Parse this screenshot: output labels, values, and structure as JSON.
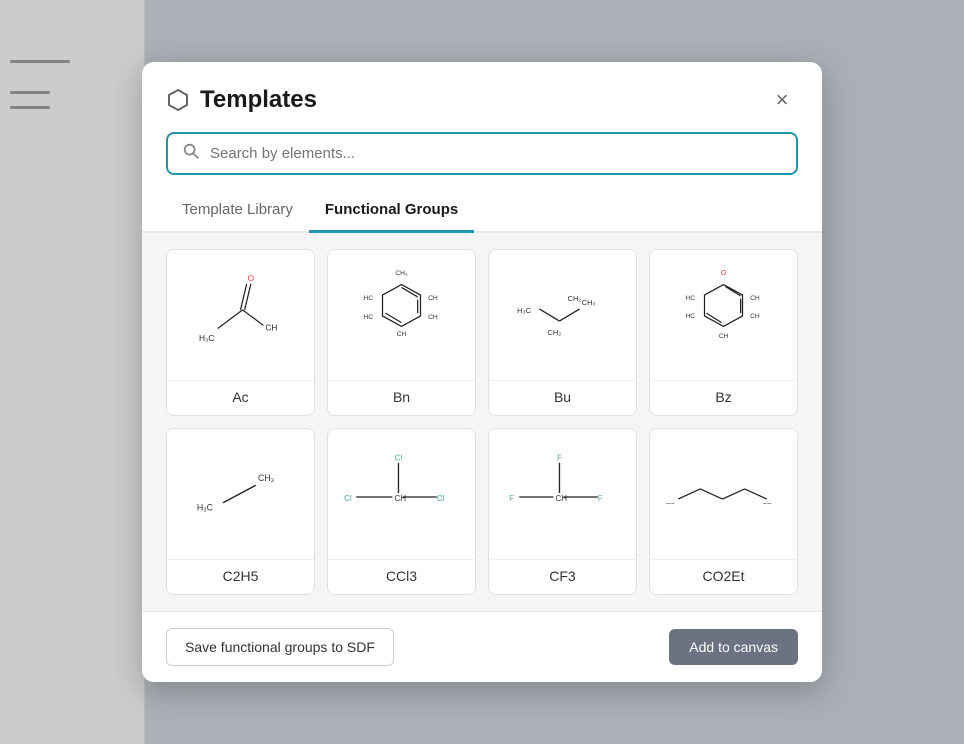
{
  "background": {
    "color": "#c8cfd6"
  },
  "modal": {
    "title": "Templates",
    "icon_name": "hexagon-icon",
    "close_label": "×"
  },
  "search": {
    "placeholder": "Search by elements..."
  },
  "tabs": [
    {
      "id": "template-library",
      "label": "Template Library",
      "active": false
    },
    {
      "id": "functional-groups",
      "label": "Functional Groups",
      "active": true
    }
  ],
  "molecules": [
    {
      "id": "Ac",
      "label": "Ac"
    },
    {
      "id": "Bn",
      "label": "Bn"
    },
    {
      "id": "Bu",
      "label": "Bu"
    },
    {
      "id": "Bz",
      "label": "Bz"
    },
    {
      "id": "C2H5",
      "label": "C2H5"
    },
    {
      "id": "CCl3",
      "label": "CCl3"
    },
    {
      "id": "CF3",
      "label": "CF3"
    },
    {
      "id": "CO2Et",
      "label": "CO2Et"
    }
  ],
  "footer": {
    "save_label": "Save functional groups to SDF",
    "add_label": "Add to canvas"
  }
}
